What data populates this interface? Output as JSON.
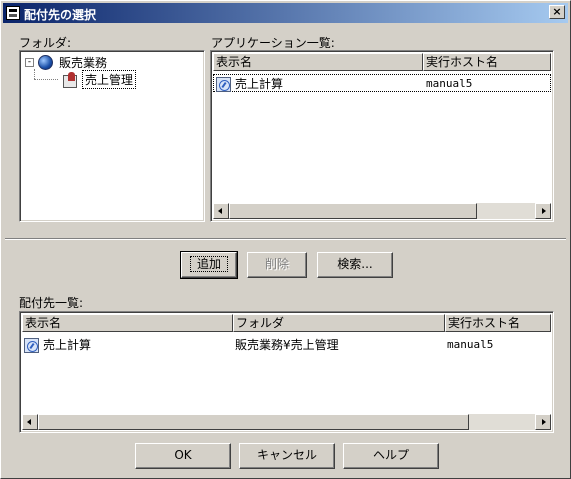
{
  "window": {
    "title": "配付先の選択",
    "close_glyph": "×"
  },
  "folder_panel": {
    "label": "フォルダ:",
    "tree": [
      {
        "label": "販売業務",
        "expander": "-",
        "icon": "globe-icon"
      },
      {
        "label": "売上管理",
        "icon": "folder-item-icon",
        "selected": true
      }
    ]
  },
  "app_panel": {
    "label": "アプリケーション一覧:",
    "columns": [
      "表示名",
      "実行ホスト名"
    ],
    "rows": [
      {
        "name": "売上計算",
        "host": "manual5"
      }
    ]
  },
  "buttons": {
    "add": "追加",
    "delete": "削除",
    "search": "検索...",
    "ok": "OK",
    "cancel": "キャンセル",
    "help": "ヘルプ"
  },
  "dest_panel": {
    "label": "配付先一覧:",
    "columns": [
      "表示名",
      "フォルダ",
      "実行ホスト名"
    ],
    "rows": [
      {
        "name": "売上計算",
        "folder": "販売業務¥売上管理",
        "host": "manual5"
      }
    ]
  }
}
